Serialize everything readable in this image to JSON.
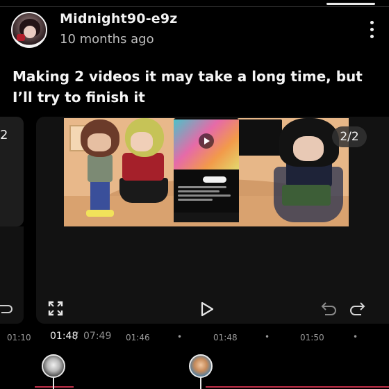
{
  "post": {
    "username": "Midnight90-e9z",
    "time": "10 months ago",
    "text": "Making 2 videos it may take a long time, but I’ll try to finish it"
  },
  "carousel": {
    "left_peek_label": "2",
    "badge": "2/2"
  },
  "player": {
    "timeline": {
      "left_label": "01:10",
      "current_time": "01:48",
      "separator": "/",
      "duration": "07:49",
      "marks": [
        "01:46",
        "01:48",
        "01:50"
      ],
      "dot": "•"
    }
  },
  "icons": {
    "more": "kebab-icon",
    "expand": "expand-icon",
    "play": "play-icon",
    "undo": "undo-icon",
    "redo": "redo-icon"
  },
  "colors": {
    "background": "#000000",
    "text": "#f2f2f2",
    "muted": "#9a9a9a",
    "track": "#c4314b"
  }
}
